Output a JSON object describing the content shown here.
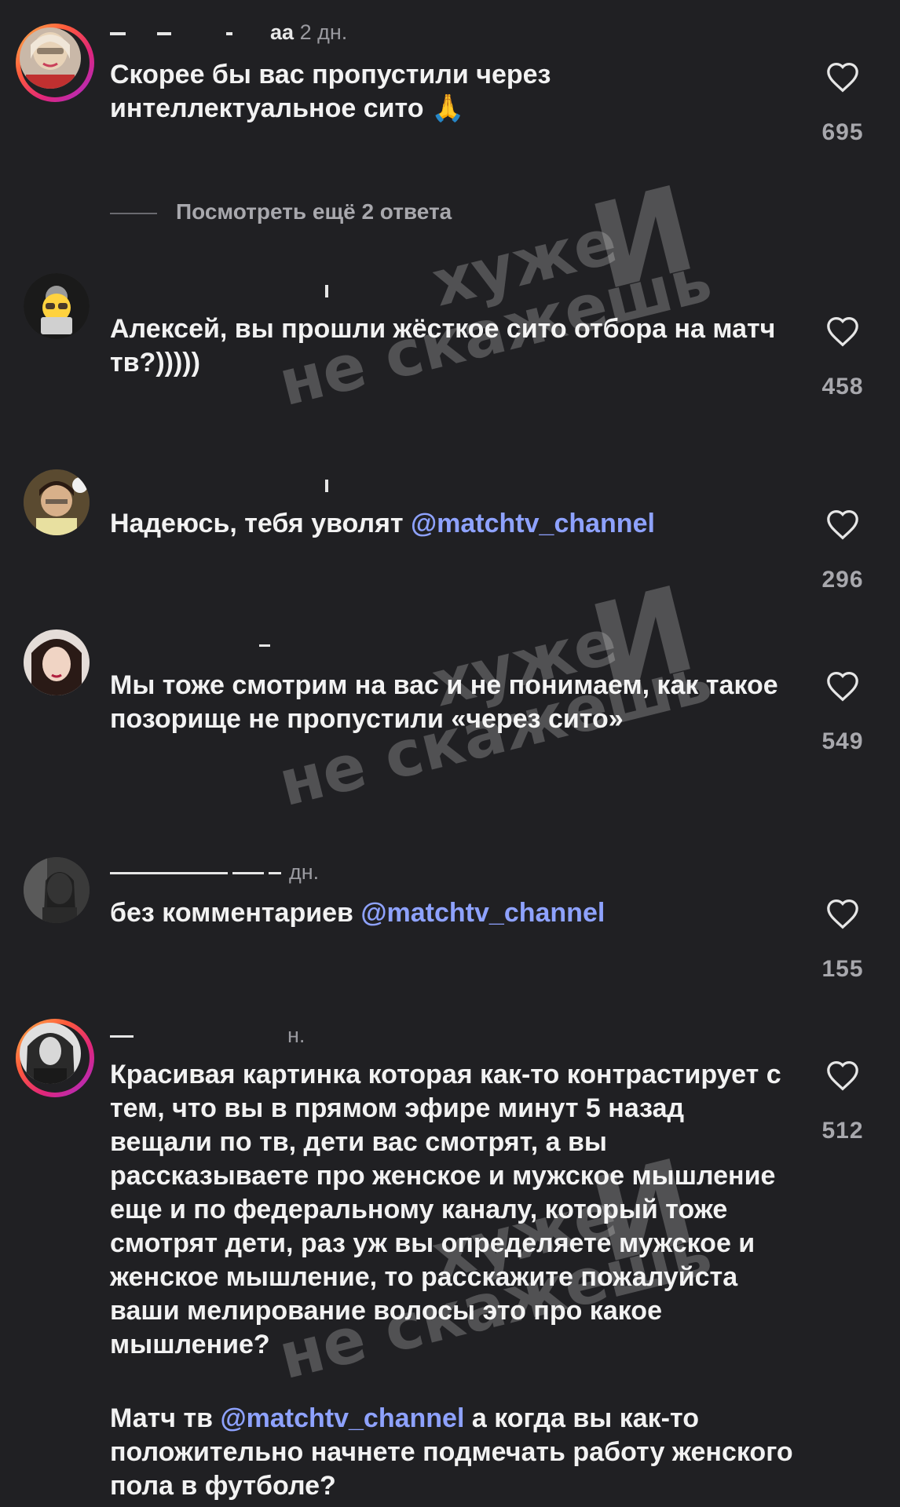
{
  "comments": [
    {
      "username_fragment": "аа",
      "time": "2 дн.",
      "text": "Скорее бы вас пропустили через интеллектуальное сито",
      "emoji": "🙏",
      "likes": "695"
    },
    {
      "username_fragment": "",
      "time": "",
      "text": "Алексей, вы прошли жёсткое сито отбора на матч тв?)))))",
      "likes": "458"
    },
    {
      "username_fragment": "",
      "time": "",
      "text": "Надеюсь, тебя уволят ",
      "mention": "@matchtv_channel",
      "likes": "296"
    },
    {
      "username_fragment": "",
      "time": "",
      "text": "Мы тоже смотрим на вас и не понимаем, как такое позорище не пропустили «через сито»",
      "likes": "549"
    },
    {
      "username_fragment": "",
      "time": "дн.",
      "text": "без комментариев ",
      "mention": "@matchtv_channel",
      "likes": "155"
    },
    {
      "username_fragment": "",
      "time": "н.",
      "text": "Красивая картинка которая как-то контрастирует с тем, что вы в прямом эфире минут 5 назад вещали по тв, дети вас смотрят, а вы рассказываете про женское и мужское мышление еще и по федеральному каналу, который тоже смотрят дети, раз уж вы определяете мужское и женское мышление, то расскажите пожалуйста ваши мелирование волосы это про какое мышление?",
      "text2_before": "Матч тв ",
      "mention": "@matchtv_channel",
      "text2_after": " а когда вы как-то положительно начнете подмечать работу женского пола в футболе?",
      "likes": "512"
    }
  ],
  "more_replies": "Посмотреть ещё 2 ответа",
  "watermark": {
    "line1": "хуже",
    "line2": "не скажешь",
    "letter": "И"
  },
  "colors": {
    "background": "#202023",
    "mention": "#8ea2ff",
    "count": "#a8a8ad"
  },
  "icons": [
    "heart-icon"
  ]
}
